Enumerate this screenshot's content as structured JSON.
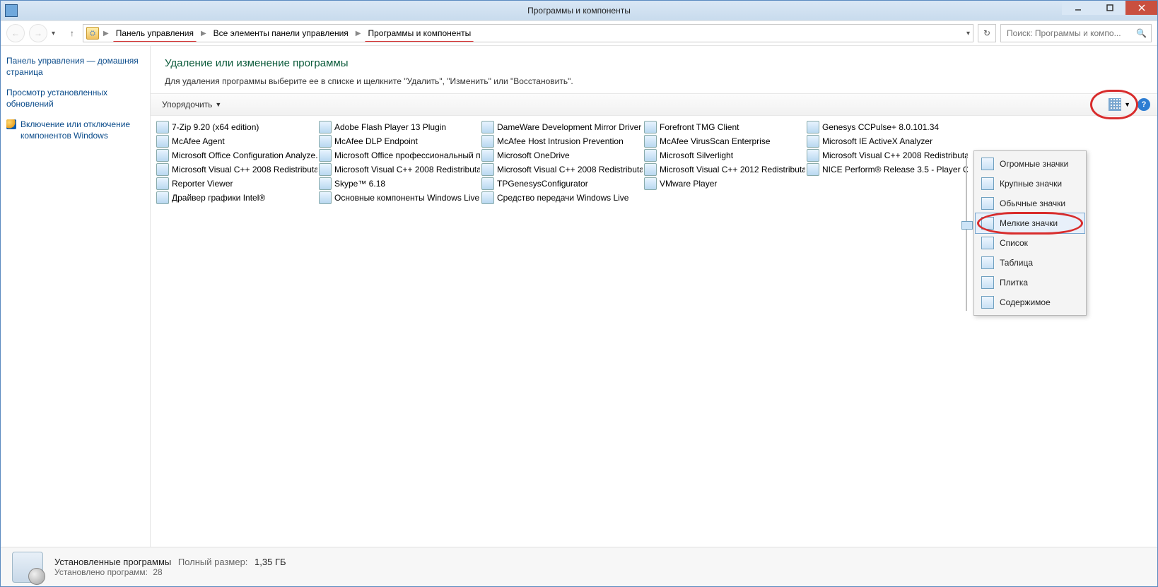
{
  "window": {
    "title": "Программы и компоненты"
  },
  "nav": {
    "breadcrumbs": [
      "Панель управления",
      "Все элементы панели управления",
      "Программы и компоненты"
    ],
    "search_placeholder": "Поиск: Программы и компо..."
  },
  "sidebar": {
    "home": "Панель управления — домашняя страница",
    "updates": "Просмотр установленных обновлений",
    "features": "Включение или отключение компонентов Windows"
  },
  "main": {
    "heading": "Удаление или изменение программы",
    "subtext": "Для удаления программы выберите ее в списке и щелкните \"Удалить\", \"Изменить\" или \"Восстановить\"."
  },
  "toolbar": {
    "organize": "Упорядочить"
  },
  "programs": [
    "7-Zip 9.20 (x64 edition)",
    "Adobe Flash Player 13 Plugin",
    "DameWare Development Mirror Driver ...",
    "Forefront TMG Client",
    "Genesys CCPulse+ 8.0.101.34",
    "McAfee Agent",
    "McAfee DLP Endpoint",
    "McAfee Host Intrusion Prevention",
    "McAfee VirusScan Enterprise",
    "Microsoft IE ActiveX Analyzer",
    "Microsoft Office Configuration Analyze...",
    "Microsoft Office профессиональный п...",
    "Microsoft OneDrive",
    "Microsoft Silverlight",
    "Microsoft Visual C++ 2008 Redistributa...",
    "Microsoft Visual C++ 2008 Redistributa...",
    "Microsoft Visual C++ 2008 Redistributa...",
    "Microsoft Visual C++ 2008 Redistributa...",
    "Microsoft Visual C++ 2012 Redistributa...",
    "NICE Perform® Release 3.5 - Player Co...",
    "Reporter Viewer",
    "Skype™ 6.18",
    "TPGenesysConfigurator",
    "VMware Player",
    "",
    "Драйвер графики Intel®",
    "Основные компоненты Windows Live",
    "Средство передачи Windows Live",
    "",
    ""
  ],
  "view_menu": {
    "items": [
      "Огромные значки",
      "Крупные значки",
      "Обычные значки",
      "Мелкие значки",
      "Список",
      "Таблица",
      "Плитка",
      "Содержимое"
    ],
    "selected_index": 3
  },
  "status": {
    "title": "Установленные программы",
    "size_label": "Полный размер:",
    "size_value": "1,35 ГБ",
    "count_label": "Установлено программ:",
    "count_value": "28"
  }
}
